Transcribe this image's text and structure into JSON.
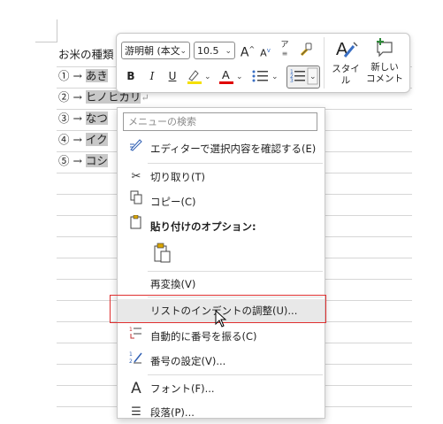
{
  "document": {
    "lines": [
      {
        "prefix": "お米の種類",
        "highlight": "",
        "mark": ""
      },
      {
        "prefix": "① → ",
        "highlight": "あき",
        "mark": ""
      },
      {
        "prefix": "② → ",
        "highlight": "ヒノヒカリ",
        "mark": "↵"
      },
      {
        "prefix": "③ → ",
        "highlight": "なつ",
        "mark": ""
      },
      {
        "prefix": "④ → ",
        "highlight": "イク",
        "mark": ""
      },
      {
        "prefix": "⑤ → ",
        "highlight": "コシ",
        "mark": ""
      }
    ]
  },
  "mini_toolbar": {
    "font_name": "游明朝 (本文",
    "font_size": "10.5",
    "grow_font": "A",
    "shrink_font": "A",
    "phonetic": "ア",
    "bold": "B",
    "italic": "I",
    "underline": "U",
    "highlight_letter": "",
    "font_color_letter": "A",
    "style_label": "スタイル",
    "comment_label_1": "新しい",
    "comment_label_2": "コメント",
    "highlight_color": "#f5e000",
    "font_color": "#e00000"
  },
  "context_menu": {
    "search_placeholder": "メニューの検索",
    "items": [
      {
        "label": "エディターで選択内容を確認する(E)",
        "icon": "editor-pen-icon"
      },
      {
        "label": "切り取り(T)",
        "icon": "scissors-icon"
      },
      {
        "label": "コピー(C)",
        "icon": "copy-icon"
      },
      {
        "label": "貼り付けのオプション:",
        "icon": "paste-clipboard-icon"
      },
      {
        "label": "再変換(V)",
        "icon": ""
      },
      {
        "label": "リストのインデントの調整(U)...",
        "icon": ""
      },
      {
        "label": "自動的に番号を振る(C)",
        "icon": "auto-number-icon"
      },
      {
        "label": "番号の設定(V)...",
        "icon": "numbering-value-icon"
      },
      {
        "label": "フォント(F)...",
        "icon": "font-icon"
      },
      {
        "label": "段落(P)...",
        "icon": "paragraph-icon"
      }
    ]
  }
}
